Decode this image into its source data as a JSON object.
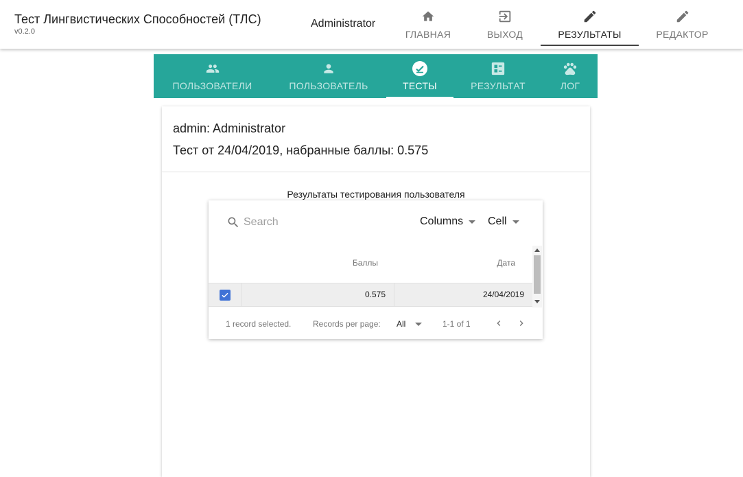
{
  "app": {
    "title": "Тест Лингвистических Способностей (ТЛС)",
    "version": "v0.2.0",
    "user": "Administrator"
  },
  "top_tabs": [
    {
      "label": "ГЛАВНАЯ",
      "icon": "home-icon",
      "active": false
    },
    {
      "label": "ВЫХОД",
      "icon": "exit-icon",
      "active": false
    },
    {
      "label": "РЕЗУЛЬТАТЫ",
      "icon": "pencil-icon",
      "active": true
    },
    {
      "label": "РЕДАКТОР",
      "icon": "pencil-icon",
      "active": false
    }
  ],
  "sub_tabs": [
    {
      "label": "ПОЛЬЗОВАТЕЛИ",
      "icon": "people-icon",
      "active": false
    },
    {
      "label": "ПОЛЬЗОВАТЕЛЬ",
      "icon": "person-icon",
      "active": false
    },
    {
      "label": "ТЕСТЫ",
      "icon": "check-circle-icon",
      "active": true
    },
    {
      "label": "РЕЗУЛЬТАТ",
      "icon": "fact-check-icon",
      "active": false
    },
    {
      "label": "ЛОГ",
      "icon": "paw-icon",
      "active": false
    }
  ],
  "card": {
    "user_line": "admin: Administrator",
    "test_line": "Тест от 24/04/2019, набранные баллы: 0.575",
    "table_caption": "Результаты тестирования пользователя"
  },
  "grid": {
    "search_placeholder": "Search",
    "columns_label": "Columns",
    "cell_label": "Cell",
    "headers": [
      "Баллы",
      "Дата"
    ],
    "rows": [
      {
        "selected": true,
        "score": "0.575",
        "date": "24/04/2019"
      }
    ],
    "footer": {
      "selected_text": "1 record selected.",
      "records_per_page_label": "Records per page:",
      "records_per_page_value": "All",
      "range_text": "1-1 of 1"
    }
  },
  "colors": {
    "accent": "#26a69a",
    "checkbox": "#3f72d6",
    "active_underline": "#424242"
  }
}
